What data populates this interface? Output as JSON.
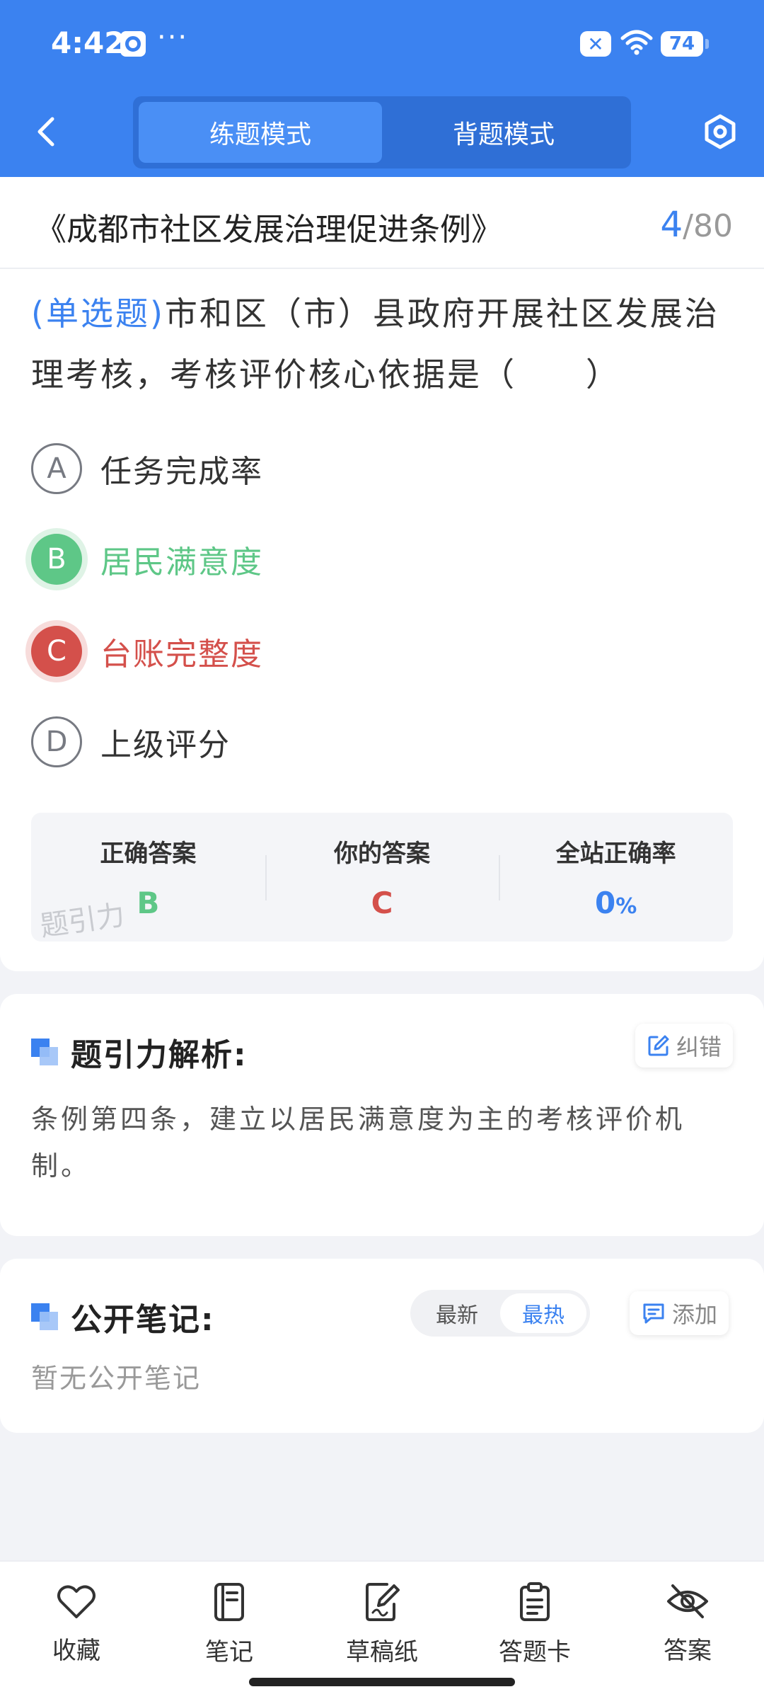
{
  "status_bar": {
    "time": "4:42",
    "dots": "···",
    "battery": "74"
  },
  "header": {
    "tabs": [
      {
        "label": "练题模式",
        "active": true
      },
      {
        "label": "背题模式",
        "active": false
      }
    ]
  },
  "question_card": {
    "doc_title": "《成都市社区发展治理促进条例》",
    "progress_current": "4",
    "progress_sep": "/",
    "progress_total": "80",
    "question_type": "(单选题)",
    "question_text": "市和区（市）县政府开展社区发展治理考核，考核评价核心依据是（　　）",
    "options": [
      {
        "letter": "A",
        "text": "任务完成率",
        "state": "normal"
      },
      {
        "letter": "B",
        "text": "居民满意度",
        "state": "correct"
      },
      {
        "letter": "C",
        "text": "台账完整度",
        "state": "wrong"
      },
      {
        "letter": "D",
        "text": "上级评分",
        "state": "normal"
      }
    ],
    "answer_summary": {
      "correct_label": "正确答案",
      "correct_value": "B",
      "your_label": "你的答案",
      "your_value": "C",
      "rate_label": "全站正确率",
      "rate_value": "0",
      "rate_unit": "%"
    },
    "watermark": "题引力"
  },
  "analysis": {
    "title": "题引力解析:",
    "report_label": "纠错",
    "text": "条例第四条，建立以居民满意度为主的考核评价机制。"
  },
  "notes": {
    "title": "公开笔记:",
    "sort_options": [
      {
        "label": "最新",
        "active": false
      },
      {
        "label": "最热",
        "active": true
      }
    ],
    "add_label": "添加",
    "empty_text": "暂无公开笔记"
  },
  "toolbar": {
    "items": [
      {
        "label": "收藏",
        "icon": "heart-icon"
      },
      {
        "label": "笔记",
        "icon": "notebook-icon"
      },
      {
        "label": "草稿纸",
        "icon": "draft-icon"
      },
      {
        "label": "答题卡",
        "icon": "answer-sheet-icon"
      },
      {
        "label": "答案",
        "icon": "eye-off-icon"
      }
    ]
  },
  "colors": {
    "primary": "#3b82f0",
    "correct": "#5ec787",
    "wrong": "#d4504b"
  }
}
